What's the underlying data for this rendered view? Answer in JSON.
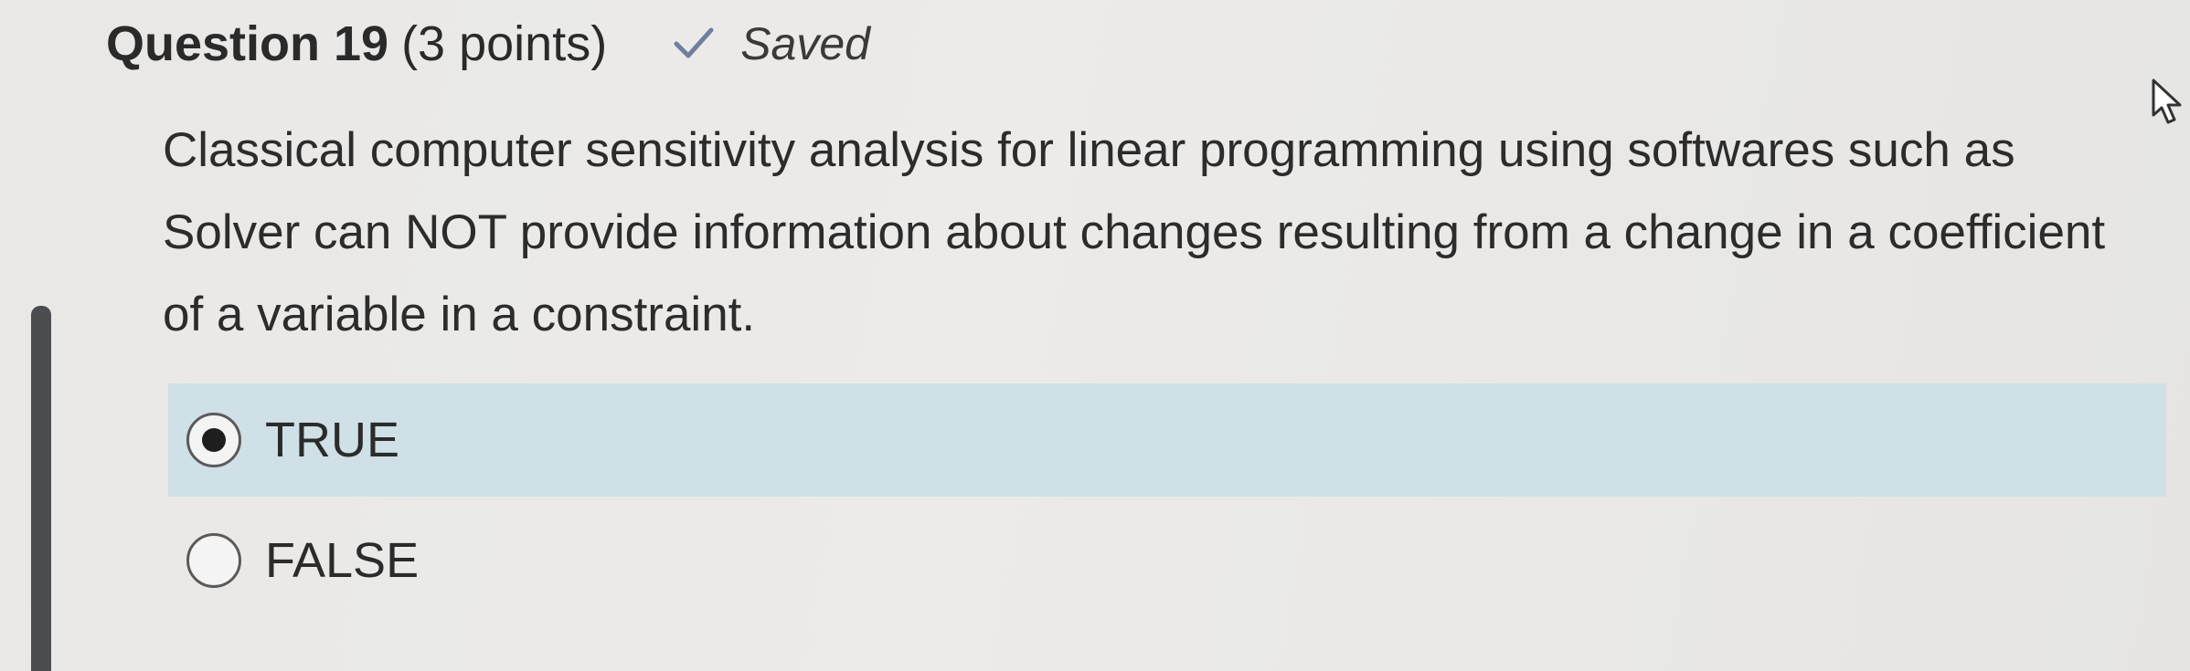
{
  "header": {
    "question_number": "Question 19",
    "points": "(3 points)",
    "status_icon": "checkmark-icon",
    "status": "Saved"
  },
  "question": {
    "text": "Classical computer sensitivity analysis for linear programming using softwares such as Solver can NOT provide information about changes resulting from a change in a coefficient of a variable in a constraint."
  },
  "options": [
    {
      "label": "TRUE",
      "selected": true
    },
    {
      "label": "FALSE",
      "selected": false
    }
  ],
  "colors": {
    "selected_option_background": "#cfe0e6",
    "left_accent_bar": "#4b4c50"
  },
  "icons": [
    "checkmark-icon",
    "radio-selected-icon",
    "radio-empty-icon",
    "mouse-pointer-icon"
  ]
}
